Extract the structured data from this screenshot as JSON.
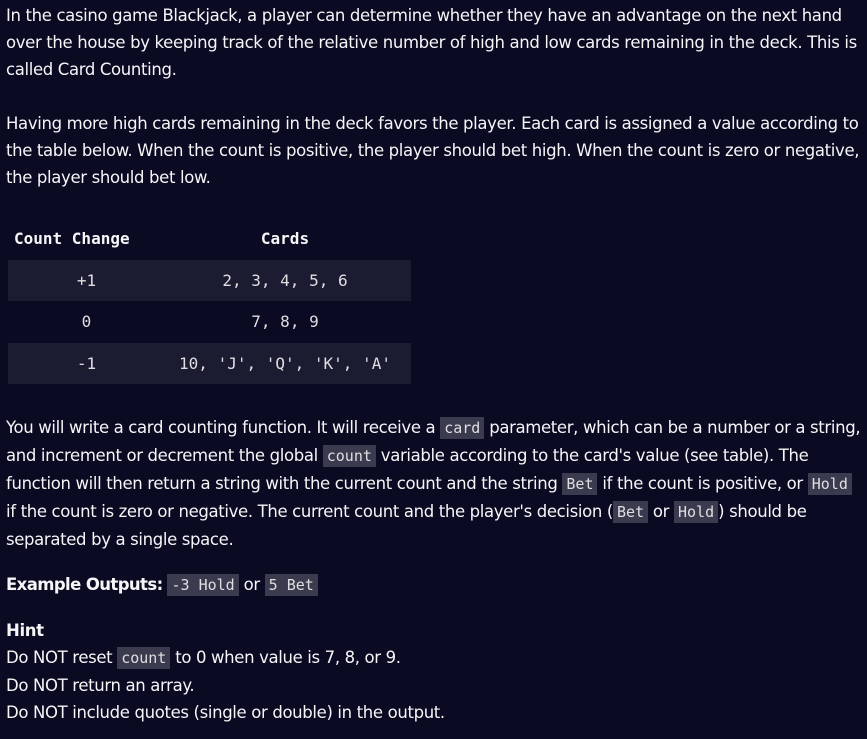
{
  "intro": {
    "p1": "In the casino game Blackjack, a player can determine whether they have an advantage on the next hand over the house by keeping track of the relative number of high and low cards remaining in the deck. This is called Card Counting.",
    "p2": "Having more high cards remaining in the deck favors the player. Each card is assigned a value according to the table below. When the count is positive, the player should bet high. When the count is zero or negative, the player should bet low."
  },
  "table": {
    "headers": [
      "Count Change",
      "Cards"
    ],
    "rows": [
      {
        "change": "+1",
        "cards": "2, 3, 4, 5, 6"
      },
      {
        "change": "0",
        "cards": "7, 8, 9"
      },
      {
        "change": "-1",
        "cards": "10, 'J', 'Q', 'K', 'A'"
      }
    ]
  },
  "description": {
    "t1": "You will write a card counting function. It will receive a ",
    "c1": "card",
    "t2": " parameter, which can be a number or a string, and increment or decrement the global ",
    "c2": "count",
    "t3": " variable according to the card's value (see table). The function will then return a string with the current count and the string ",
    "c3": "Bet",
    "t4": " if the count is positive, or ",
    "c4": "Hold",
    "t5": " if the count is zero or negative. The current count and the player's decision (",
    "c5": "Bet",
    "t6": " or ",
    "c6": "Hold",
    "t7": ") should be separated by a single space."
  },
  "example": {
    "label": "Example Outputs:",
    "c1": "-3 Hold",
    "sep": " or ",
    "c2": "5 Bet"
  },
  "hint": {
    "title": "Hint",
    "l1_a": "Do NOT reset ",
    "l1_code": "count",
    "l1_b": " to 0 when value is 7, 8, or 9.",
    "l2": "Do NOT return an array.",
    "l3": "Do NOT include quotes (single or double) in the output."
  }
}
